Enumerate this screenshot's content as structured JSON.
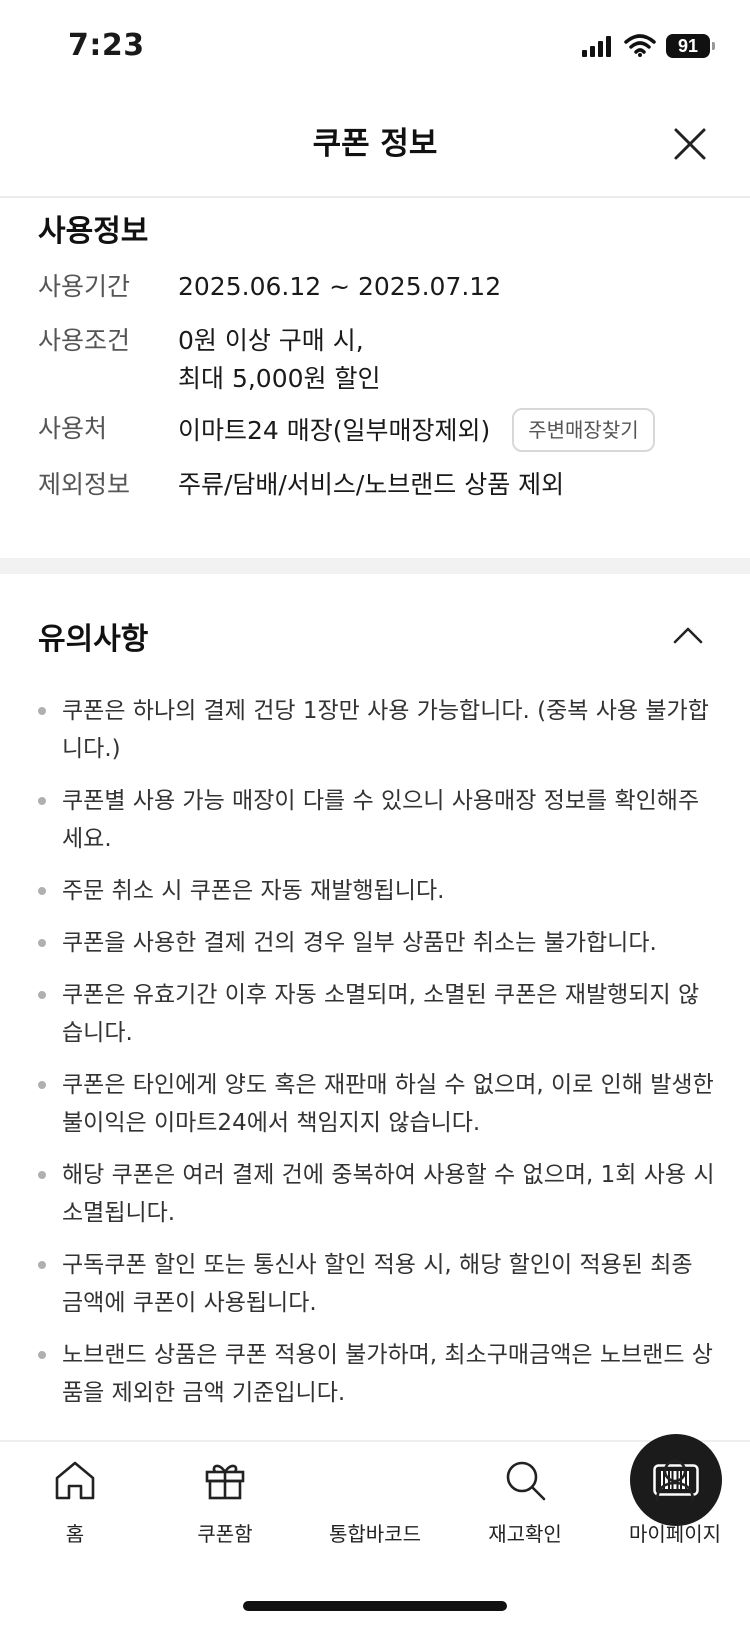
{
  "status_bar": {
    "time": "7:23",
    "battery": "91",
    "icons": [
      "cellular-signal-icon",
      "wifi-icon",
      "battery-icon"
    ]
  },
  "header": {
    "title": "쿠폰 정보",
    "close_icon": "close-icon"
  },
  "usage": {
    "title": "사용정보",
    "rows": [
      {
        "label": "사용기간",
        "value": "2025.06.12 ~ 2025.07.12"
      },
      {
        "label": "사용조건",
        "value": "0원 이상 구매 시,\n최대 5,000원 할인"
      },
      {
        "label": "사용처",
        "value": "이마트24 매장(일부매장제외)",
        "button": "주변매장찾기"
      },
      {
        "label": "제외정보",
        "value": "주류/담배/서비스/노브랜드 상품 제외"
      }
    ]
  },
  "notice": {
    "title": "유의사항",
    "toggle_icon": "chevron-up-icon",
    "items": [
      "쿠폰은 하나의 결제 건당 1장만 사용 가능합니다. (중복 사용 불가합니다.)",
      "쿠폰별 사용 가능 매장이 다를 수 있으니 사용매장 정보를 확인해주세요.",
      "주문 취소 시 쿠폰은 자동 재발행됩니다.",
      "쿠폰을 사용한 결제 건의 경우 일부 상품만 취소는 불가합니다.",
      "쿠폰은 유효기간 이후 자동 소멸되며, 소멸된 쿠폰은 재발행되지 않습니다.",
      "쿠폰은 타인에게 양도 혹은 재판매 하실 수 없으며, 이로 인해 발생한 불이익은 이마트24에서 책임지지 않습니다.",
      "해당 쿠폰은 여러 결제 건에 중복하여 사용할 수 없으며, 1회 사용 시 소멸됩니다.",
      "구독쿠폰 할인 또는 통신사 할인 적용 시, 해당 할인이 적용된 최종 금액에 쿠폰이 사용됩니다.",
      "노브랜드 상품은 쿠폰 적용이 불가하며, 최소구매금액은 노브랜드 상품을 제외한 금액 기준입니다."
    ]
  },
  "bottom_nav": {
    "items": [
      {
        "label": "홈",
        "icon": "home-icon"
      },
      {
        "label": "쿠폰함",
        "icon": "gift-icon"
      },
      {
        "label": "통합바코드",
        "icon": "barcode-icon"
      },
      {
        "label": "재고확인",
        "icon": "search-icon"
      },
      {
        "label": "마이페이지",
        "icon": "person-icon"
      }
    ]
  }
}
